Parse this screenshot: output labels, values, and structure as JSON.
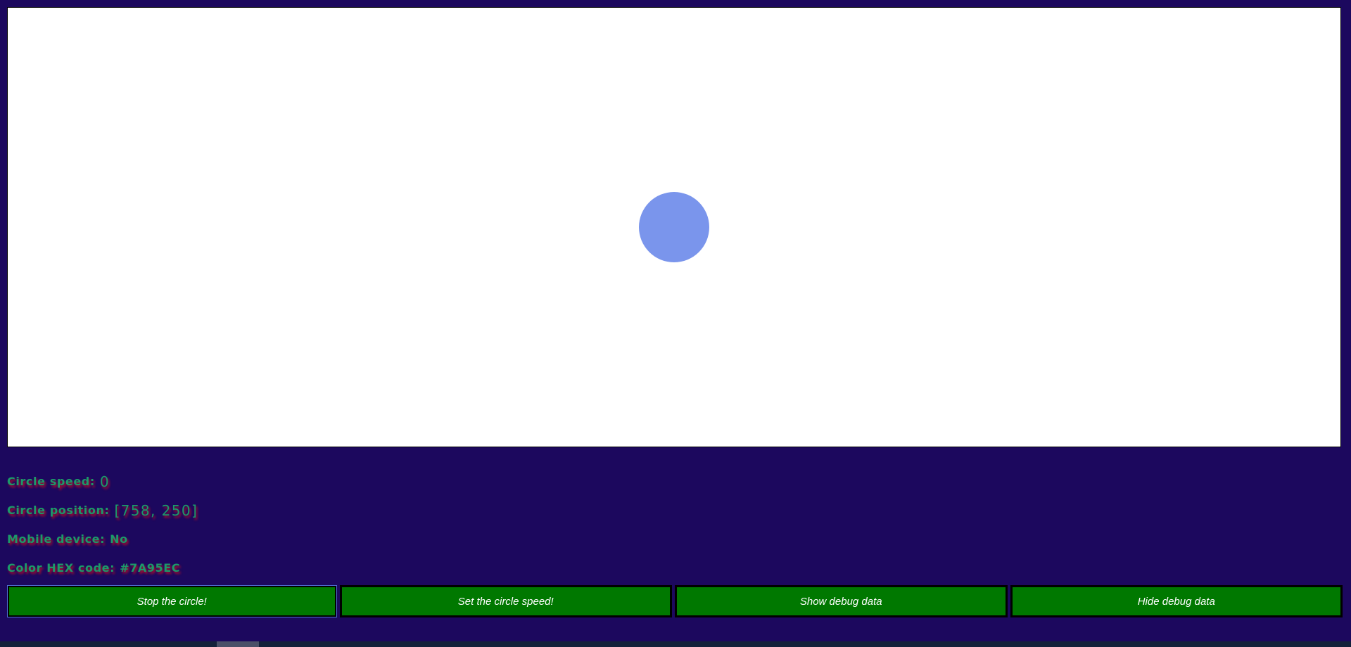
{
  "canvas": {
    "circle_color": "#7A95EC"
  },
  "debug": {
    "speed_label": "Circle speed:",
    "speed_value": "0",
    "position_label": "Circle position:",
    "position_value": "[758, 250]",
    "mobile_label": "Mobile device:",
    "mobile_value": "No",
    "color_label": "Color HEX code:",
    "color_value": "#7A95EC"
  },
  "buttons": {
    "stop": "Stop the circle!",
    "set_speed": "Set the circle speed!",
    "show_debug": "Show debug data",
    "hide_debug": "Hide debug data"
  },
  "colors": {
    "page_background": "#1C085E",
    "button_background": "#007800",
    "debug_text": "#1B9A6A",
    "debug_shadow": "#B0102A"
  }
}
